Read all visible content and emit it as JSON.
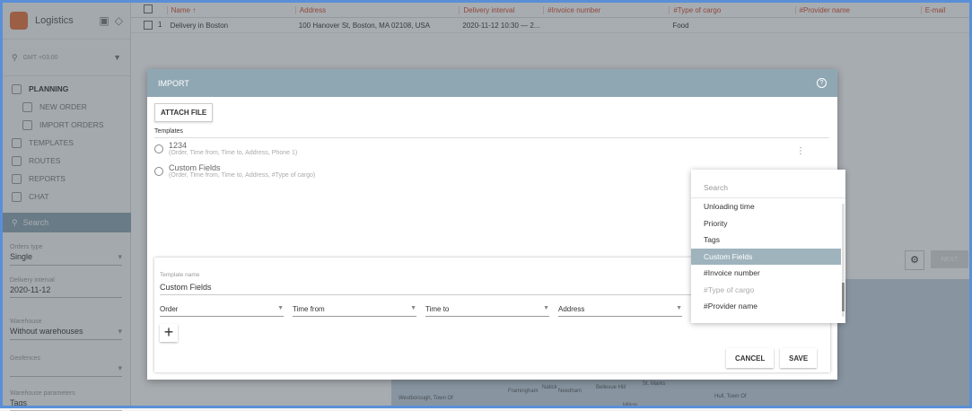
{
  "sidebar": {
    "app_title": "Logistics",
    "timezone": "GMT +03:00",
    "nav": [
      {
        "label": "Planning",
        "active": true,
        "sub": false
      },
      {
        "label": "New order",
        "active": false,
        "sub": true
      },
      {
        "label": "Import orders",
        "active": false,
        "sub": true
      },
      {
        "label": "Templates",
        "active": false,
        "sub": false
      },
      {
        "label": "Routes",
        "active": false,
        "sub": false
      },
      {
        "label": "Reports",
        "active": false,
        "sub": false
      },
      {
        "label": "Chat",
        "active": false,
        "sub": false
      }
    ],
    "search_label": "Search",
    "fields": [
      {
        "label": "Orders type",
        "value": "Single",
        "dropdown": true
      },
      {
        "label": "Delivery interval",
        "value": "2020-11-12",
        "dropdown": false
      },
      {
        "label": "Warehouse",
        "value": "Without warehouses",
        "dropdown": true
      },
      {
        "label": "Geofences",
        "value": "",
        "dropdown": true
      },
      {
        "label": "Warehouse parameters",
        "value": "Tags",
        "dropdown": false
      }
    ]
  },
  "table": {
    "columns": [
      "Name ↑",
      "Address",
      "Delivery interval",
      "#Invoice number",
      "#Type of cargo",
      "#Provider name",
      "E-mail"
    ],
    "rows": [
      {
        "num": "1",
        "cells": [
          "Delivery in Boston",
          "100 Hanover St, Boston, MA 02108, USA",
          "2020-11-12 10:30 — 2...",
          "",
          "Food",
          "",
          ""
        ]
      }
    ]
  },
  "map_labels": [
    "Westborough, Town Of",
    "Framingham",
    "Natick",
    "Needham",
    "Bellevue Hill",
    "Milton",
    "Hull, Town Of",
    "St. Marks"
  ],
  "dialog": {
    "title": "IMPORT",
    "attach_label": "ATTACH FILE",
    "templates_label": "Templates",
    "templates": [
      {
        "name": "1234",
        "desc": "(Order, Time from, Time to, Address, Phone 1)"
      },
      {
        "name": "Custom Fields",
        "desc": "(Order, Time from, Time to, Address, #Type of cargo)"
      }
    ],
    "template_name_label": "Template name",
    "template_name_value": "Custom Fields",
    "selects": [
      "Order",
      "Time from",
      "Time to",
      "Address"
    ],
    "cancel_label": "CANCEL",
    "save_label": "SAVE"
  },
  "dropdown": {
    "placeholder": "Search",
    "items": [
      {
        "label": "Unloading time",
        "state": "normal"
      },
      {
        "label": "Priority",
        "state": "normal"
      },
      {
        "label": "Tags",
        "state": "normal"
      },
      {
        "label": "Custom Fields",
        "state": "highlighted"
      },
      {
        "label": "#Invoice number",
        "state": "normal"
      },
      {
        "label": "#Type of cargo",
        "state": "disabled"
      },
      {
        "label": "#Provider name",
        "state": "normal"
      }
    ]
  },
  "next_label": "NEXT",
  "colors": {
    "header_bar": "#8fa7b3",
    "accent_text": "#d64a2e",
    "logo": "#e8743c",
    "frame": "#5a8fd8"
  }
}
